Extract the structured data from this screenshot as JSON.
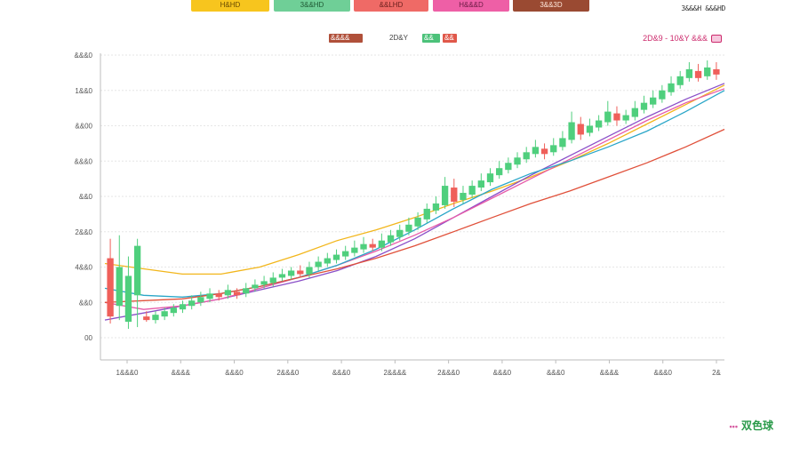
{
  "top_tabs": [
    {
      "label": "H&HD",
      "color": "#f7c51e",
      "text_color": "#6a4c00"
    },
    {
      "label": "3&&HD",
      "color": "#6fcf97",
      "text_color": "#1f5a34"
    },
    {
      "label": "&&LHD",
      "color": "#ef6a66",
      "text_color": "#6a1f1d"
    },
    {
      "label": "H&&&D",
      "color": "#ee5fa6",
      "text_color": "#6a1a44"
    },
    {
      "label": "3&&3D",
      "color": "#9a4a32",
      "text_color": "#ffe8dc"
    }
  ],
  "top_right_text": "3&&&H &&&HD",
  "legend": {
    "item1_label": "&&&&",
    "item1_color": "#b0503a",
    "item2_label": "2D&Y",
    "item3_label": "&&",
    "item3_color": "#4cc27a",
    "item4_label": "&&",
    "item4_color": "#e0584a",
    "right_text": "2D&9 - 10&Y &&&"
  },
  "brand_text": "双色球",
  "colors": {
    "up": "#4fcf7d",
    "down": "#ef5f5a",
    "grid": "#e6e6e6",
    "axis": "#bdbdbd",
    "ma_yellow": "#f2b61b",
    "ma_purple": "#8a4fc8",
    "ma_pink": "#e75aa8",
    "ma_teal": "#2aa6c8",
    "ma_red": "#e0503a"
  },
  "chart_data": {
    "type": "candlestick",
    "y_ticks": [
      "&&&0",
      "1&&0",
      "&&00",
      "&&&0",
      "&&0",
      "2&&0",
      "4&&0",
      "&&0",
      "00"
    ],
    "x_ticks": [
      "1&&&0",
      "&&&&",
      "&&&0",
      "2&&&0",
      "&&&0",
      "2&&&&",
      "2&&&0",
      "&&&0",
      "&&&0",
      "&&&&",
      "&&&0",
      "2&"
    ],
    "ylim": [
      0,
      16
    ],
    "candles": [
      [
        4.5,
        1.2,
        5.6,
        0.8
      ],
      [
        1.8,
        4.0,
        5.8,
        1.0
      ],
      [
        0.9,
        3.5,
        4.6,
        0.5
      ],
      [
        2.4,
        5.2,
        5.6,
        0.6
      ],
      [
        1.2,
        1.0,
        1.5,
        0.9
      ],
      [
        1.0,
        1.3,
        1.5,
        0.8
      ],
      [
        1.2,
        1.5,
        1.7,
        1.0
      ],
      [
        1.4,
        1.7,
        1.9,
        1.2
      ],
      [
        1.6,
        1.9,
        2.1,
        1.4
      ],
      [
        1.8,
        2.1,
        2.4,
        1.6
      ],
      [
        2.0,
        2.3,
        2.6,
        1.8
      ],
      [
        2.2,
        2.5,
        2.8,
        2.0
      ],
      [
        2.5,
        2.3,
        2.7,
        2.1
      ],
      [
        2.4,
        2.7,
        3.0,
        2.2
      ],
      [
        2.6,
        2.4,
        2.8,
        2.2
      ],
      [
        2.5,
        2.8,
        3.1,
        2.3
      ],
      [
        2.8,
        3.0,
        3.3,
        2.6
      ],
      [
        3.0,
        3.2,
        3.5,
        2.8
      ],
      [
        3.1,
        3.4,
        3.7,
        2.9
      ],
      [
        3.4,
        3.6,
        3.9,
        3.2
      ],
      [
        3.5,
        3.8,
        4.0,
        3.3
      ],
      [
        3.8,
        3.6,
        4.1,
        3.4
      ],
      [
        3.6,
        4.0,
        4.3,
        3.4
      ],
      [
        4.0,
        4.3,
        4.6,
        3.8
      ],
      [
        4.2,
        4.5,
        4.8,
        4.0
      ],
      [
        4.4,
        4.7,
        5.0,
        4.2
      ],
      [
        4.6,
        4.9,
        5.2,
        4.4
      ],
      [
        4.8,
        5.1,
        5.5,
        4.6
      ],
      [
        5.0,
        5.3,
        5.7,
        4.8
      ],
      [
        5.3,
        5.1,
        5.6,
        4.9
      ],
      [
        5.1,
        5.5,
        5.9,
        4.9
      ],
      [
        5.4,
        5.8,
        6.1,
        5.2
      ],
      [
        5.7,
        6.1,
        6.4,
        5.5
      ],
      [
        6.0,
        6.4,
        6.8,
        5.8
      ],
      [
        6.3,
        6.8,
        7.1,
        6.1
      ],
      [
        6.7,
        7.3,
        7.6,
        6.5
      ],
      [
        7.2,
        7.6,
        8.0,
        7.0
      ],
      [
        7.5,
        8.6,
        9.1,
        7.3
      ],
      [
        8.5,
        7.7,
        9.0,
        7.4
      ],
      [
        7.8,
        8.2,
        8.6,
        7.6
      ],
      [
        8.1,
        8.6,
        8.9,
        7.9
      ],
      [
        8.5,
        8.9,
        9.3,
        8.3
      ],
      [
        8.8,
        9.3,
        9.6,
        8.6
      ],
      [
        9.2,
        9.6,
        10.0,
        9.0
      ],
      [
        9.5,
        9.9,
        10.2,
        9.3
      ],
      [
        9.8,
        10.2,
        10.5,
        9.6
      ],
      [
        10.1,
        10.5,
        10.8,
        9.9
      ],
      [
        10.4,
        10.8,
        11.2,
        10.2
      ],
      [
        10.7,
        10.4,
        11.0,
        10.1
      ],
      [
        10.5,
        10.9,
        11.3,
        10.3
      ],
      [
        10.8,
        11.3,
        11.7,
        10.6
      ],
      [
        11.2,
        12.2,
        12.8,
        11.0
      ],
      [
        12.1,
        11.5,
        12.5,
        11.2
      ],
      [
        11.6,
        12.0,
        12.4,
        11.4
      ],
      [
        11.9,
        12.3,
        12.6,
        11.7
      ],
      [
        12.2,
        12.8,
        13.4,
        12.0
      ],
      [
        12.7,
        12.3,
        13.1,
        12.0
      ],
      [
        12.3,
        12.6,
        12.9,
        12.1
      ],
      [
        12.5,
        13.0,
        13.4,
        12.3
      ],
      [
        12.9,
        13.3,
        13.7,
        12.7
      ],
      [
        13.2,
        13.6,
        14.0,
        13.0
      ],
      [
        13.5,
        14.0,
        14.3,
        13.3
      ],
      [
        13.9,
        14.4,
        14.8,
        13.7
      ],
      [
        14.3,
        14.8,
        15.1,
        14.1
      ],
      [
        14.7,
        15.2,
        15.6,
        14.5
      ],
      [
        15.1,
        14.7,
        15.5,
        14.5
      ],
      [
        14.8,
        15.3,
        15.7,
        14.6
      ],
      [
        15.2,
        14.9,
        15.6,
        14.6
      ]
    ],
    "ma_lines": [
      {
        "color_key": "ma_yellow",
        "y": [
          4.2,
          3.9,
          3.6,
          3.6,
          4.0,
          4.7,
          5.5,
          6.1,
          6.8,
          7.6,
          8.3,
          9.1,
          10.0,
          11.0,
          12.1,
          13.2,
          14.3
        ]
      },
      {
        "color_key": "ma_purple",
        "y": [
          1.0,
          1.4,
          1.8,
          2.2,
          2.7,
          3.2,
          3.8,
          4.6,
          5.6,
          6.8,
          8.0,
          9.2,
          10.3,
          11.4,
          12.5,
          13.5,
          14.4
        ]
      },
      {
        "color_key": "ma_pink",
        "y": [
          2.0,
          1.6,
          1.8,
          2.2,
          2.8,
          3.4,
          4.1,
          4.9,
          5.8,
          6.8,
          7.9,
          9.0,
          10.1,
          11.2,
          12.3,
          13.3,
          14.1
        ]
      },
      {
        "color_key": "ma_teal",
        "y": [
          2.8,
          2.4,
          2.3,
          2.5,
          2.9,
          3.4,
          4.1,
          5.0,
          6.1,
          7.3,
          8.4,
          9.3,
          10.0,
          10.8,
          11.7,
          12.8,
          14.0
        ]
      },
      {
        "color_key": "ma_red",
        "y": [
          2.0,
          2.1,
          2.2,
          2.5,
          2.9,
          3.4,
          3.9,
          4.5,
          5.2,
          6.0,
          6.8,
          7.6,
          8.3,
          9.1,
          9.9,
          10.8,
          11.8
        ]
      }
    ]
  }
}
